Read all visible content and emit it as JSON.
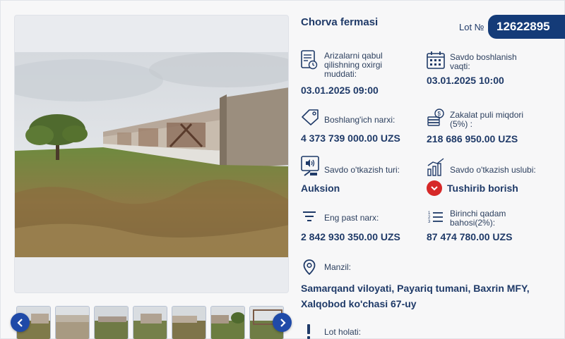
{
  "lot": {
    "title": "Chorva fermasi",
    "number_label": "Lot №",
    "number": "12622895"
  },
  "fields": {
    "application_deadline": {
      "label": "Arizalarni qabul qilishning oxirgi muddati:",
      "value": "03.01.2025 09:00"
    },
    "auction_start": {
      "label": "Savdo boshlanish vaqti:",
      "value": "03.01.2025 10:00"
    },
    "start_price": {
      "label": "Boshlang'ich narxi:",
      "value": "4 373 739 000.00 UZS"
    },
    "deposit": {
      "label": "Zakalat puli miqdori (5%) :",
      "value": "218 686 950.00 UZS"
    },
    "auction_type": {
      "label": "Savdo o'tkazish turi:",
      "value": "Auksion"
    },
    "auction_method": {
      "label": "Savdo o'tkazish uslubi:",
      "value": "Tushirib borish"
    },
    "min_price": {
      "label": "Eng past narx:",
      "value": "2 842 930 350.00 UZS"
    },
    "first_step": {
      "label": "Birinchi qadam bahosi(2%):",
      "value": "87 474 780.00 UZS"
    },
    "address": {
      "label": "Manzil:",
      "value": "Samarqand viloyati, Payariq tumani, Baxrin MFY, Xalqobod ko'chasi 67-uy"
    },
    "lot_status": {
      "label": "Lot holati:"
    }
  },
  "icons": {
    "prev": "chevron-left-icon",
    "next": "chevron-right-icon",
    "deadline": "document-clock-icon",
    "start": "calendar-icon",
    "price": "price-tag-icon",
    "deposit": "money-stack-icon",
    "type": "auction-gavel-icon",
    "method": "bar-chart-icon",
    "min_price": "sort-filter-icon",
    "first_step": "numbered-list-icon",
    "address": "map-pin-icon",
    "status": "exclamation-icon"
  },
  "colors": {
    "primary": "#143b78",
    "accent_blue": "#1f4aa8",
    "text": "#1f3a68",
    "method_badge": "#d62828"
  }
}
